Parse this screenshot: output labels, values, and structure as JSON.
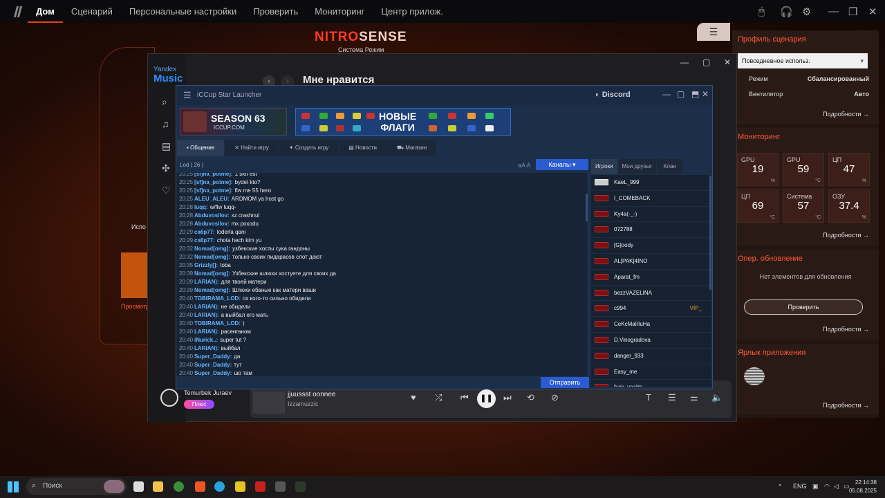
{
  "nitrosense": {
    "nav": [
      "Дом",
      "Сценарий",
      "Персональные настройки",
      "Проверить",
      "Мониторинг",
      "Центр прилож."
    ],
    "brand_a": "NITRO",
    "brand_b": "SENSE",
    "subtitle": "Система Режим",
    "left_text1": "Испо",
    "left_text2": "Просмотр",
    "profile": {
      "title": "Профиль сценария",
      "select": "Повседневное использ.",
      "mode_label": "Режим",
      "mode_value": "Сбалансированный",
      "fan_label": "Вентилятор",
      "fan_value": "Авто",
      "more": "Подробности →"
    },
    "monitoring": {
      "title": "Мониторинг",
      "tiles": [
        {
          "label": "GPU",
          "value": "19",
          "unit": "%"
        },
        {
          "label": "GPU",
          "value": "59",
          "unit": "°C"
        },
        {
          "label": "ЦП",
          "value": "47",
          "unit": "%"
        },
        {
          "label": "ЦП",
          "value": "69",
          "unit": "°C"
        },
        {
          "label": "Система",
          "value": "57",
          "unit": "°C"
        },
        {
          "label": "ОЗУ",
          "value": "37.4",
          "unit": "%"
        }
      ],
      "more": "Подробности →"
    },
    "update": {
      "title": "Опер. обновление",
      "empty": "Нет элементов для обновления",
      "button": "Проверить",
      "more": "Подробности →"
    },
    "shortcut": {
      "title": "Ярлык приложения",
      "more": "Подробности →"
    }
  },
  "yandex": {
    "logo_top": "Yandex",
    "logo_bottom": "Music",
    "page_title": "Мне нравится",
    "user": "Temurbek Juraev",
    "plus": "Плюс",
    "track_title": "jjuussst oonnee",
    "track_artist": "Izzamuzzic"
  },
  "iccup": {
    "title": "iCCup Star Launcher",
    "discord": "Discord",
    "banner1_title": "SEASON 63",
    "banner1_sub": "ICCUP.COM",
    "banner2_line1": "НОВЫЕ",
    "banner2_line2": "ФЛАГИ",
    "tabs": [
      "Общение",
      "Найти игру",
      "Создать игру",
      "Новости",
      "Магазин"
    ],
    "room": "Lod  ( 26 )",
    "font_toggle": "aA A",
    "channels": "Каналы",
    "panel_tabs": [
      "Игроки",
      "Мои друзья",
      "Клан"
    ],
    "send": "Отправить",
    "chat": [
      {
        "t": "20:25",
        "n": "[sf]na_potme]:",
        "m": "1 slot est"
      },
      {
        "t": "20:25",
        "n": "[sf]na_potme]:",
        "m": "bydet kto?"
      },
      {
        "t": "20:25",
        "n": "[sf]na_potme]:",
        "m": "flw me 55 hero"
      },
      {
        "t": "20:25",
        "n": "ALEU_ALEU:",
        "m": "ARDMOM ya host go"
      },
      {
        "t": "20:28",
        "n": "luqq:",
        "m": "w/flw luqq-"
      },
      {
        "t": "20:28",
        "n": "Abduvosilov:",
        "m": "xz crashnul"
      },
      {
        "t": "20:28",
        "n": "Abduvosilov:",
        "m": "mx poxodu"
      },
      {
        "t": "20:29",
        "n": "ca6p77:",
        "m": "loderla qani"
      },
      {
        "t": "20:29",
        "n": "ca6p77:",
        "m": "chota hech kim yu"
      },
      {
        "t": "20:32",
        "n": "Nomad[omg]:",
        "m": "узбекские хосты сука гандоны"
      },
      {
        "t": "20:32",
        "n": "Nomad[omg]:",
        "m": "только своих пидарасов слот дают"
      },
      {
        "t": "20:35",
        "n": "Grizzly[]:",
        "m": "toba"
      },
      {
        "t": "20:39",
        "n": "Nomad[omg]:",
        "m": "Узбекские шлюхи хостуете для своих да"
      },
      {
        "t": "20:39",
        "n": "LARIAN):",
        "m": "для твоей матери"
      },
      {
        "t": "20:39",
        "n": "Nomad[omg]:",
        "m": "Шлюхи ебаные как матери ваши"
      },
      {
        "t": "20:40",
        "n": "TOBIRAMA_LOD:",
        "m": "ох кого-то сильно обидели"
      },
      {
        "t": "20:40",
        "n": "LARIAN):",
        "m": "не обидели"
      },
      {
        "t": "20:40",
        "n": "LARIAN):",
        "m": "а выйбал его мать"
      },
      {
        "t": "20:40",
        "n": "TOBIRAMA_LOD:",
        "m": ")"
      },
      {
        "t": "20:40",
        "n": "LARIAN):",
        "m": "расенганом"
      },
      {
        "t": "20:40",
        "n": "iNurick..:",
        "m": "super tut ?"
      },
      {
        "t": "20:40",
        "n": "LARIAN):",
        "m": "выйбал"
      },
      {
        "t": "20:40",
        "n": "Super_Daddy:",
        "m": "да"
      },
      {
        "t": "20:40",
        "n": "Super_Daddy:",
        "m": "тут"
      },
      {
        "t": "20:40",
        "n": "Super_Daddy:",
        "m": "шо там"
      }
    ],
    "players": [
      {
        "name": "KaeL_999",
        "vip": ""
      },
      {
        "name": "I_COMEBACK",
        "vip": ""
      },
      {
        "name": "Ky4a(-_-)",
        "vip": ""
      },
      {
        "name": "072788",
        "vip": ""
      },
      {
        "name": "[G]oody",
        "vip": ""
      },
      {
        "name": "AL[PAK]4INO",
        "vip": ""
      },
      {
        "name": "Aparat_fm",
        "vip": ""
      },
      {
        "name": "bezzVAZELINA",
        "vip": ""
      },
      {
        "name": "c994",
        "vip": "VIP_"
      },
      {
        "name": "CeKcMaIIIuHa",
        "vip": ""
      },
      {
        "name": "D.Vinogradova",
        "vip": ""
      },
      {
        "name": "danger_933",
        "vip": ""
      },
      {
        "name": "Easy_me",
        "vip": ""
      },
      {
        "name": "fuck_yeahh",
        "vip": ""
      }
    ]
  },
  "taskbar": {
    "search": "Поиск",
    "lang": "ENG",
    "time": "22:14:38",
    "date": "05.08.2025"
  }
}
